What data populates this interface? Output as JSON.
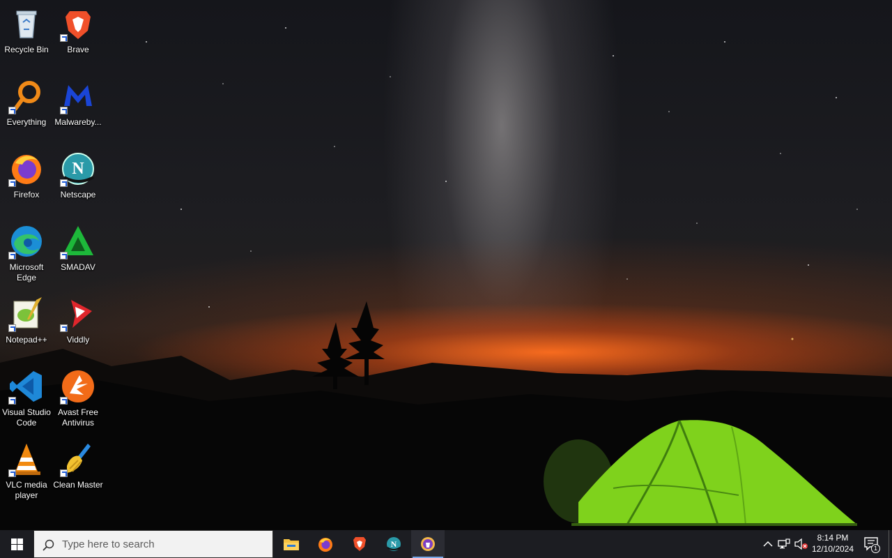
{
  "desktop": {
    "icons": [
      {
        "label": "Recycle Bin",
        "icon": "recycle-bin-icon"
      },
      {
        "label": "Brave",
        "icon": "brave-icon"
      },
      {
        "label": "Everything",
        "icon": "everything-icon"
      },
      {
        "label": "Malwareby...",
        "icon": "malwarebytes-icon"
      },
      {
        "label": "Firefox",
        "icon": "firefox-icon"
      },
      {
        "label": "Netscape",
        "icon": "netscape-icon"
      },
      {
        "label": "Microsoft Edge",
        "icon": "edge-icon"
      },
      {
        "label": "SMADAV",
        "icon": "smadav-icon"
      },
      {
        "label": "Notepad++",
        "icon": "notepadpp-icon"
      },
      {
        "label": "Viddly",
        "icon": "viddly-icon"
      },
      {
        "label": "Visual Studio Code",
        "icon": "vscode-icon"
      },
      {
        "label": "Avast Free Antivirus",
        "icon": "avast-icon"
      },
      {
        "label": "VLC media player",
        "icon": "vlc-icon"
      },
      {
        "label": "Clean Master",
        "icon": "clean-master-icon"
      }
    ]
  },
  "taskbar": {
    "search_placeholder": "Type here to search",
    "pinned_apps": [
      "File Explorer",
      "Firefox",
      "Brave",
      "Netscape",
      "Tor Browser"
    ],
    "active_app": "Tor Browser",
    "clock": {
      "time": "8:14 PM",
      "date": "12/10/2024"
    },
    "notifications_count": "1"
  },
  "colors": {
    "taskbar_bg": "#1c1d22",
    "active_indicator": "#78a8e8",
    "tent_green": "#7fd21c"
  }
}
